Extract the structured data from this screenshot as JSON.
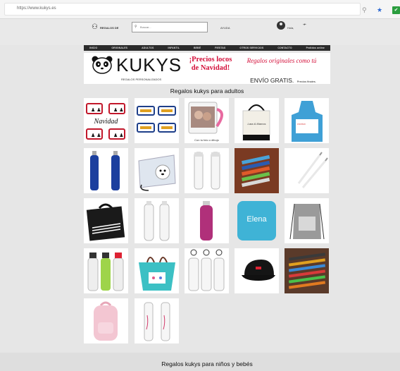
{
  "browser": {
    "url": "https://www.kukys.es",
    "zoom_icon": "magnifier-icon",
    "bookmark_icon": "star-icon",
    "extension_icon": "check-icon"
  },
  "header": {
    "logo_text": "REGALOS DE",
    "search_placeholder": "Buscar...",
    "help_link": "AYUDA",
    "user_label": "Hola,"
  },
  "nav": {
    "items": [
      "INICIO",
      "ORIGINALES",
      "ADULTOS",
      "INFANTIL",
      "BEBÉ",
      "FIESTAS",
      "OTROS SERVICIOS",
      "CONTACTO",
      "Pedidos online"
    ]
  },
  "banner": {
    "brand": "KUKYS",
    "brand_sub": "REGALOS PERSONALIZADOS",
    "promo_line1": "¡Precios locos",
    "promo_line2": "de Navidad!",
    "promo_script": "Regalos originales como tú",
    "shipping_big": "ENVÍO GRATIS.",
    "shipping_small": "Precios finales."
  },
  "sections": {
    "adults_title": "Regalos kukys para adultos",
    "kids_title": "Regalos kukys para niños y bebés"
  },
  "products": [
    {
      "name": "navidad-mugs",
      "caption": "",
      "text": "Navidad"
    },
    {
      "name": "couple-mugs",
      "caption": ""
    },
    {
      "name": "photo-mug",
      "caption": "Con tu foto o dibujo"
    },
    {
      "name": "tote-bag",
      "caption": "",
      "text": "Lara & Marcos"
    },
    {
      "name": "apron",
      "caption": ""
    },
    {
      "name": "blue-bottles",
      "caption": ""
    },
    {
      "name": "dog-pouch",
      "caption": ""
    },
    {
      "name": "white-thermos",
      "caption": ""
    },
    {
      "name": "pens-box",
      "caption": ""
    },
    {
      "name": "pencils-white",
      "caption": ""
    },
    {
      "name": "laptop-sleeve",
      "caption": ""
    },
    {
      "name": "white-bottles",
      "caption": ""
    },
    {
      "name": "pink-bottle",
      "caption": ""
    },
    {
      "name": "elena-mousepad",
      "caption": "",
      "text": "Elena"
    },
    {
      "name": "gray-backpack",
      "caption": ""
    },
    {
      "name": "kids-bottles",
      "caption": ""
    },
    {
      "name": "teal-bag",
      "caption": ""
    },
    {
      "name": "aluminium-bottles",
      "caption": ""
    },
    {
      "name": "black-cap",
      "caption": ""
    },
    {
      "name": "color-pens",
      "caption": ""
    },
    {
      "name": "pink-backpack",
      "caption": ""
    },
    {
      "name": "white-thermos-2",
      "caption": ""
    }
  ],
  "colors": {
    "nav_bg": "#2b2b2b",
    "promo_red": "#d4113b",
    "elena_blue": "#3fb3d6",
    "page_bg": "#e6e6e6"
  }
}
